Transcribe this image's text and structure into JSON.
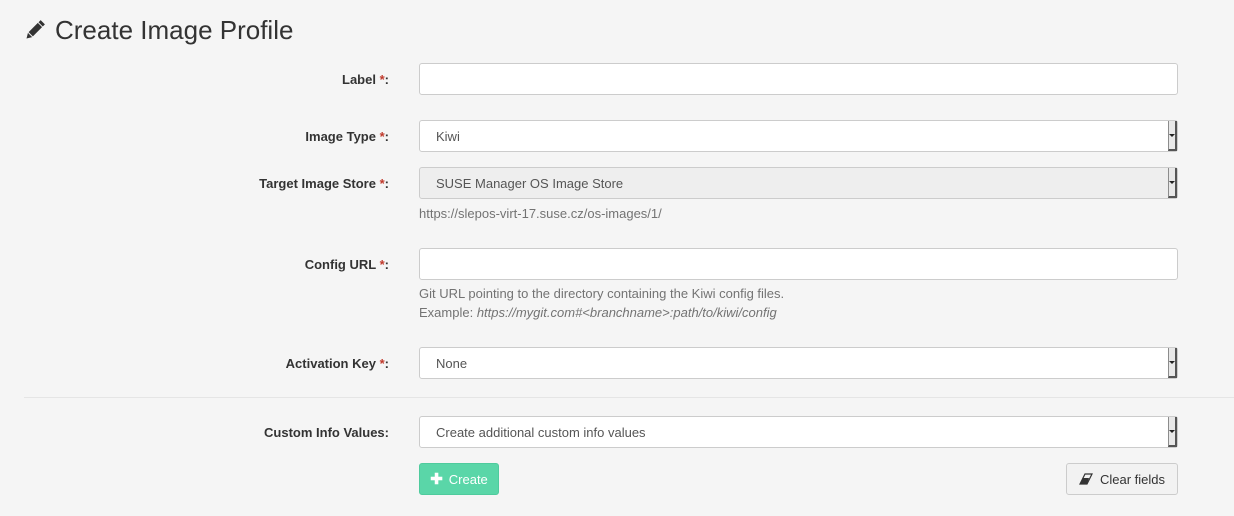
{
  "page": {
    "title": "Create Image Profile",
    "title_icon": "pencil-icon"
  },
  "form": {
    "required_marker": "*",
    "label_field": {
      "label": "Label",
      "colon": ":",
      "value": ""
    },
    "image_type": {
      "label": "Image Type",
      "colon": ":",
      "selected": "Kiwi"
    },
    "target_image_store": {
      "label": "Target Image Store",
      "colon": ":",
      "selected": "SUSE Manager OS Image Store",
      "help": "https://slepos-virt-17.suse.cz/os-images/1/"
    },
    "config_url": {
      "label": "Config URL",
      "colon": ":",
      "value": "",
      "help_line1": "Git URL pointing to the directory containing the Kiwi config files.",
      "help_example_prefix": "Example:",
      "help_example_value": "https://mygit.com#<branchname>:path/to/kiwi/config"
    },
    "activation_key": {
      "label": "Activation Key",
      "colon": ":",
      "selected": "None"
    },
    "custom_info_values": {
      "label": "Custom Info Values:",
      "placeholder": "Create additional custom info values"
    }
  },
  "buttons": {
    "create_label": "Create",
    "create_icon": "plus-icon",
    "clear_label": "Clear fields",
    "clear_icon": "eraser-icon"
  },
  "colors": {
    "required": "#c0392b",
    "create_button": "#5ad6a8",
    "background": "#f5f5f5"
  }
}
